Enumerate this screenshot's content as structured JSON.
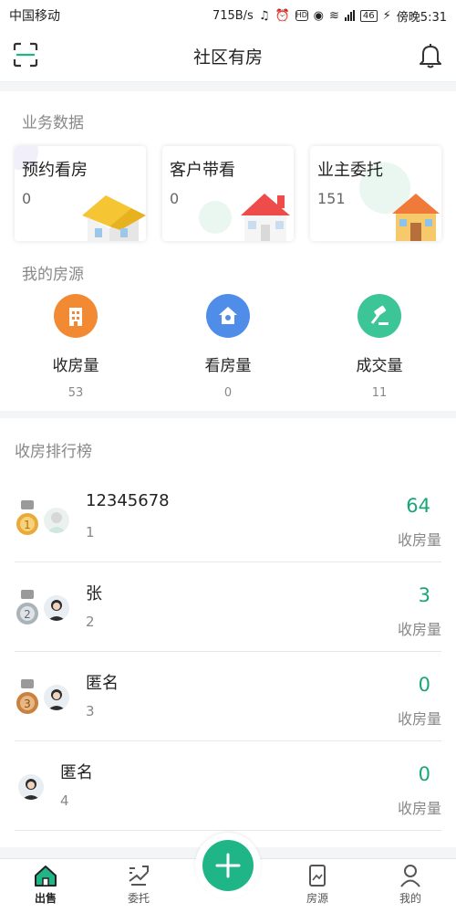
{
  "status_bar": {
    "carrier": "中国移动",
    "speed": "715B/s",
    "network": "46",
    "battery": "46",
    "time": "傍晚5:31"
  },
  "header": {
    "title": "社区有房"
  },
  "business": {
    "title": "业务数据",
    "cards": [
      {
        "label": "预约看房",
        "value": "0"
      },
      {
        "label": "客户带看",
        "value": "0"
      },
      {
        "label": "业主委托",
        "value": "151"
      }
    ]
  },
  "my_houses": {
    "title": "我的房源",
    "stats": [
      {
        "label": "收房量",
        "value": "53",
        "color": "#f28a33",
        "icon": "building-icon"
      },
      {
        "label": "看房量",
        "value": "0",
        "color": "#4f8de8",
        "icon": "house-eye-icon"
      },
      {
        "label": "成交量",
        "value": "11",
        "color": "#3cc597",
        "icon": "gavel-icon"
      }
    ]
  },
  "ranking": {
    "title": "收房排行榜",
    "unit": "收房量",
    "rows": [
      {
        "name": "12345678",
        "rank": "1",
        "count": "64",
        "medal": "1"
      },
      {
        "name": "张",
        "rank": "2",
        "count": "3",
        "medal": "2"
      },
      {
        "name": "匿名",
        "rank": "3",
        "count": "0",
        "medal": "3"
      },
      {
        "name": "匿名",
        "rank": "4",
        "count": "0",
        "medal": ""
      }
    ]
  },
  "tabbar": {
    "tabs": [
      {
        "label": "出售",
        "icon": "home-icon",
        "active": true
      },
      {
        "label": "委托",
        "icon": "entrust-icon",
        "active": false
      },
      {
        "label": "",
        "icon": "plus-icon",
        "active": false
      },
      {
        "label": "房源",
        "icon": "listing-icon",
        "active": false
      },
      {
        "label": "我的",
        "icon": "user-icon",
        "active": false
      }
    ]
  },
  "colors": {
    "accent": "#1fb587",
    "count_text": "#18a57a"
  }
}
